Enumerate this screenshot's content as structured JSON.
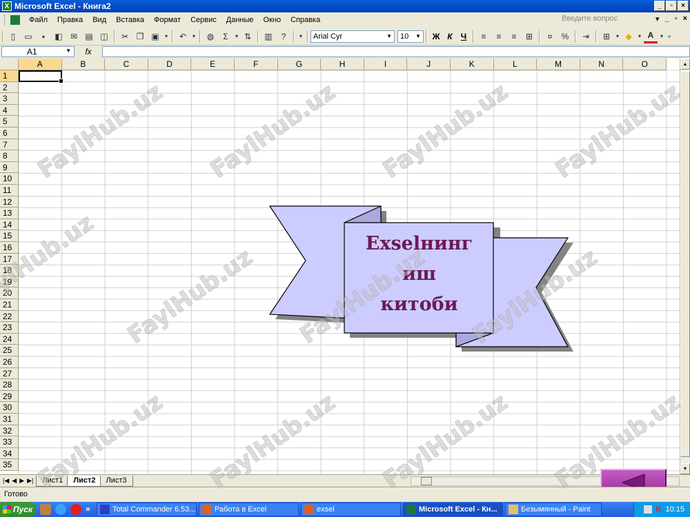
{
  "window": {
    "title": "Microsoft Excel - Книга2",
    "app_icon": "X",
    "controls": [
      "_",
      "▫",
      "×"
    ]
  },
  "menubar": {
    "items": [
      "Файл",
      "Правка",
      "Вид",
      "Вставка",
      "Формат",
      "Сервис",
      "Данные",
      "Окно",
      "Справка"
    ],
    "help_placeholder": "Введите вопрос",
    "doc_controls": [
      "▾",
      "_",
      "▫",
      "×"
    ]
  },
  "toolbar": {
    "font_name": "Arial Cyr",
    "font_size": "10",
    "bold_label": "Ж",
    "italic_label": "К",
    "underline_label": "Ч",
    "sigma_label": "Σ",
    "percent_label": "%",
    "font_color_label": "A"
  },
  "formula": {
    "cell_ref": "A1",
    "fx_label": "fx",
    "value": ""
  },
  "grid": {
    "columns": [
      "A",
      "B",
      "C",
      "D",
      "E",
      "F",
      "G",
      "H",
      "I",
      "J",
      "K",
      "L",
      "M",
      "N",
      "O"
    ],
    "rows": [
      "1",
      "2",
      "3",
      "4",
      "5",
      "6",
      "7",
      "8",
      "9",
      "10",
      "11",
      "12",
      "13",
      "14",
      "15",
      "16",
      "17",
      "18",
      "19",
      "20",
      "21",
      "22",
      "23",
      "24",
      "25",
      "26",
      "27",
      "28",
      "29",
      "30",
      "31",
      "32",
      "33",
      "34",
      "35"
    ],
    "selected_cell": "A1"
  },
  "banner": {
    "text_lines": [
      "Exselнинг",
      "иш",
      "китоби"
    ],
    "fill_color": "#ccccff",
    "text_color": "#6b1a56"
  },
  "sheets": {
    "tabs": [
      "Лист1",
      "Лист2",
      "Лист3"
    ],
    "active": "Лист2",
    "nav_glyphs": [
      "|◀",
      "◀",
      "▶",
      "▶|"
    ]
  },
  "status": {
    "text": "Готово"
  },
  "taskbar": {
    "start_label": "Пуск",
    "more_label": "»",
    "buttons": [
      {
        "label": "Total Commander 6.53...",
        "active": false
      },
      {
        "label": "Работа в Excel",
        "active": false
      },
      {
        "label": "exsel",
        "active": false
      },
      {
        "label": "Microsoft Excel - Кн...",
        "active": true
      },
      {
        "label": "Безымянный - Paint",
        "active": false
      }
    ],
    "clock": "10:15"
  },
  "watermark": {
    "text": "FaylHub.uz"
  },
  "colors": {
    "titlebar": "#0a5fd8",
    "banner_fill": "#ccccff",
    "banner_text": "#6b1a56",
    "nav_button": "#b040b0"
  }
}
